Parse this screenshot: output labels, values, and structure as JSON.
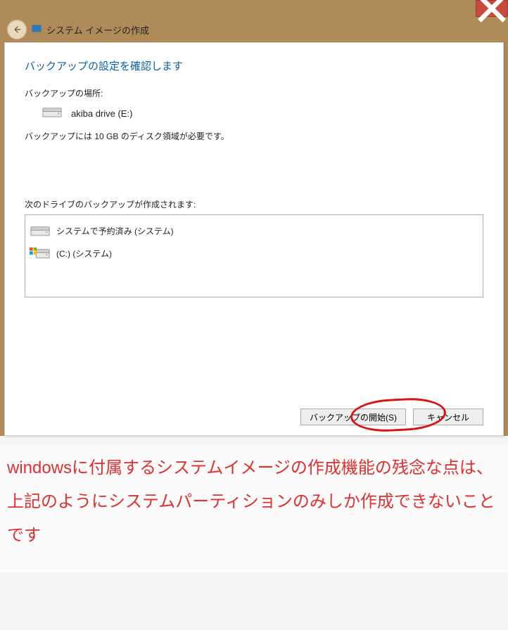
{
  "window": {
    "title": "システム イメージの作成"
  },
  "dialog": {
    "heading": "バックアップの設定を確認します",
    "location_label": "バックアップの場所:",
    "location_value": "akiba drive (E:)",
    "requirement": "バックアップには 10 GB のディスク領域が必要です。",
    "drives_label": "次のドライブのバックアップが作成されます:",
    "drives": [
      {
        "label": "システムで予約済み (システム)",
        "icon": "drive"
      },
      {
        "label": "(C:) (システム)",
        "icon": "windows-drive"
      }
    ],
    "start_button": "バックアップの開始(S)",
    "cancel_button": "キャンセル"
  },
  "commentary": "windowsに付属するシステムイメージの作成機能の残念な点は、上記のようにシステムパーティションのみしか作成できないことです"
}
